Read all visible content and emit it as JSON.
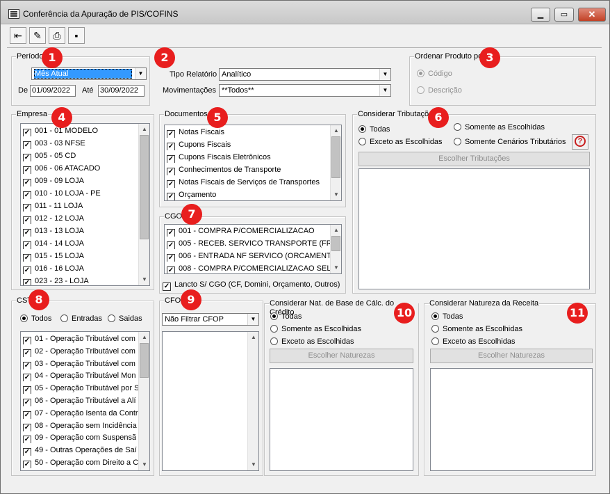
{
  "window": {
    "title": "Conferência da Apuração de PIS/COFINS",
    "minimize": "▁",
    "maximize": "▭",
    "close": "✕"
  },
  "toolbar": {
    "exit": "⇤",
    "clear": "✎",
    "print": "⎙",
    "save": "▪"
  },
  "periodo": {
    "title": "Período",
    "combo": "Mês Atual",
    "de_label": "De",
    "de": "01/09/2022",
    "ate_label": "Até",
    "ate": "30/09/2022"
  },
  "relatorio": {
    "tipo_label": "Tipo Relatório",
    "tipo": "Analítico",
    "mov_label": "Movimentações",
    "mov": "**Todos**"
  },
  "ordenar": {
    "title": "Ordenar Produto por",
    "codigo": "Código",
    "descricao": "Descrição"
  },
  "empresa": {
    "title": "Empresa",
    "items": [
      "001 - 01 MODELO",
      "003 - 03 NFSE",
      "005 - 05 CD",
      "006 - 06 ATACADO",
      "009 - 09 LOJA",
      "010 - 10 LOJA - PE",
      "011 - 11 LOJA",
      "012 - 12 LOJA",
      "013 - 13 LOJA",
      "014 - 14 LOJA",
      "015 - 15 LOJA",
      "016 - 16 LOJA",
      "023 - 23 - LOJA"
    ]
  },
  "documentos": {
    "title": "Documentos",
    "items": [
      "Notas Fiscais",
      "Cupons Fiscais",
      "Cupons Fiscais Eletrônicos",
      "Conhecimentos de Transporte",
      "Notas Fiscais de Serviços de Transportes",
      "Orçamento"
    ]
  },
  "cgo": {
    "title": "CGO",
    "items": [
      "001 - COMPRA P/COMERCIALIZACAO",
      "005 - RECEB. SERVICO TRANSPORTE (FR",
      "006 - ENTRADA NF SERVICO (ORCAMENT",
      "008 - COMPRA P/COMERCIALIZACAO SEL"
    ],
    "lancto": "Lancto S/ CGO (CF, Domini, Orçamento, Outros)"
  },
  "tributacoes": {
    "title": "Considerar Tributações",
    "todas": "Todas",
    "somente": "Somente as Escolhidas",
    "exceto": "Exceto as Escolhidas",
    "cenarios": "Somente Cenários Tributários",
    "button": "Escolher Tributações"
  },
  "cst": {
    "title": "CST",
    "todos": "Todos",
    "entradas": "Entradas",
    "saidas": "Saidas",
    "items": [
      "01 - Operação Tributável com",
      "02 - Operação Tributável com",
      "03 - Operação Tributável com",
      "04 - Operação Tributável Mon",
      "05 - Operação Tributável por S",
      "06 - Operação Tributável a Alí",
      "07 - Operação Isenta da Contri",
      "08 - Operação sem Incidência",
      "09 - Operação com Suspensã",
      "49 - Outras Operações de Saí",
      "50 - Operação com Direito a C"
    ]
  },
  "cfop": {
    "title": "CFOP",
    "combo": "Não Filtrar CFOP"
  },
  "natbase": {
    "title": "Considerar Nat. de Base de Cálc. do Crédito",
    "todas": "Todas",
    "somente": "Somente as Escolhidas",
    "exceto": "Exceto as Escolhidas",
    "button": "Escolher Naturezas"
  },
  "natreceita": {
    "title": "Considerar Natureza da Receita",
    "todas": "Todas",
    "somente": "Somente as Escolhidas",
    "exceto": "Exceto as Escolhidas",
    "button": "Escolher Naturezas"
  },
  "badges": [
    "1",
    "2",
    "3",
    "4",
    "5",
    "6",
    "7",
    "8",
    "9",
    "10",
    "11"
  ],
  "colors": {
    "badge": "#e81e1e",
    "selection": "#3399ff",
    "window_bg": "#f0f0f0"
  }
}
